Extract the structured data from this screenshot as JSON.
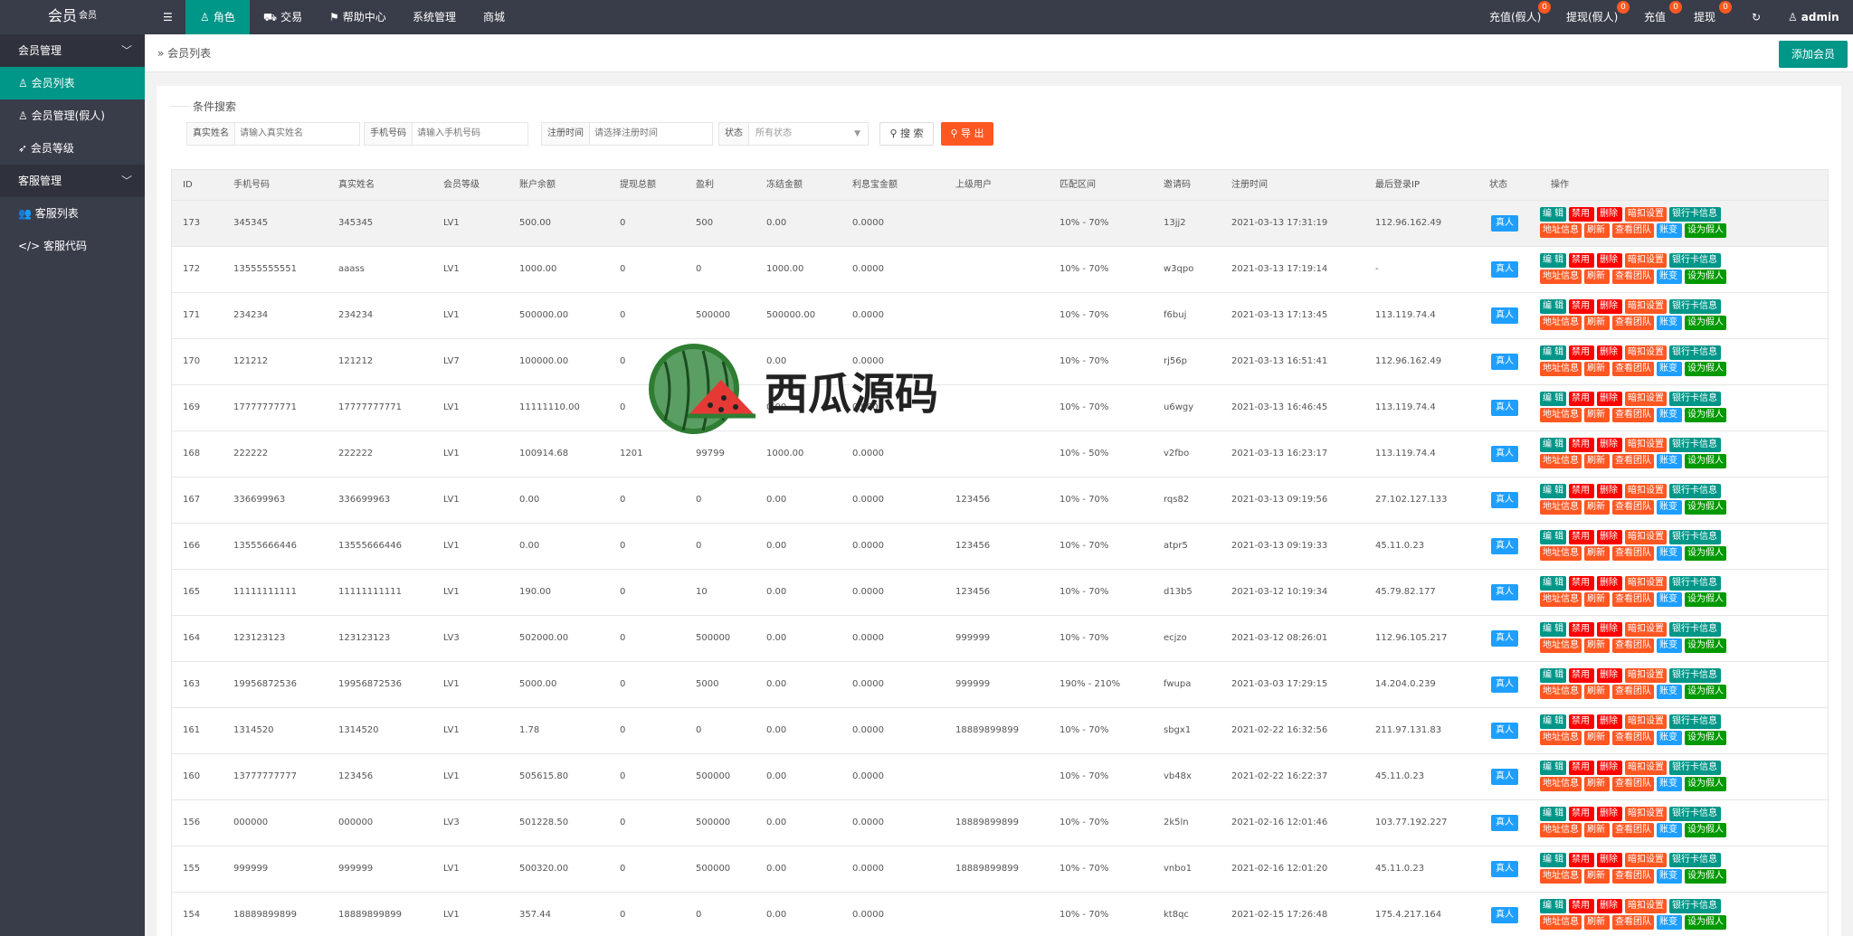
{
  "app": {
    "logo": "会员",
    "logo_sub": "会员"
  },
  "topnav": {
    "items": [
      "角色",
      "交易",
      "帮助中心",
      "系统管理",
      "商城"
    ],
    "right": [
      {
        "label": "充值(假人)",
        "count": "0"
      },
      {
        "label": "提现(假人)",
        "count": "0"
      },
      {
        "label": "充值",
        "count": "0"
      },
      {
        "label": "提现",
        "count": "0"
      }
    ],
    "user": "admin"
  },
  "sidebar": {
    "group1": "会员管理",
    "items1": [
      "会员列表",
      "会员管理(假人)",
      "会员等级"
    ],
    "group2": "客服管理",
    "items2": [
      "客服列表",
      "客服代码"
    ]
  },
  "breadcrumb": "会员列表",
  "add_button": "添加会员",
  "search": {
    "legend": "条件搜索",
    "fields": [
      {
        "label": "真实姓名",
        "placeholder": "请输入真实姓名"
      },
      {
        "label": "手机号码",
        "placeholder": "请输入手机号码"
      },
      {
        "label": "注册时间",
        "placeholder": "请选择注册时间"
      },
      {
        "label": "状态",
        "placeholder": "所有状态"
      }
    ],
    "search_btn": "搜 索",
    "export_btn": "导 出"
  },
  "table": {
    "columns": [
      "ID",
      "手机号码",
      "真实姓名",
      "会员等级",
      "账户余额",
      "提现总额",
      "盈利",
      "冻结金额",
      "利息宝金额",
      "上级用户",
      "匹配区间",
      "邀请码",
      "注册时间",
      "最后登录IP",
      "状态",
      "操作"
    ],
    "ops_row1": [
      "编 辑",
      "禁用",
      "删除",
      "暗扣设置",
      "银行卡信息"
    ],
    "ops_row2": [
      "地址信息",
      "刷新",
      "查看团队",
      "账变",
      "设为假人"
    ],
    "rows": [
      [
        "173",
        "345345",
        "345345",
        "LV1",
        "500.00",
        "0",
        "500",
        "0.00",
        "0.0000",
        "",
        "10% - 70%",
        "13jj2",
        "2021-03-13 17:31:19",
        "112.96.162.49",
        "真人"
      ],
      [
        "172",
        "13555555551",
        "aaass",
        "LV1",
        "1000.00",
        "0",
        "0",
        "1000.00",
        "0.0000",
        "",
        "10% - 70%",
        "w3qpo",
        "2021-03-13 17:19:14",
        "-",
        "真人"
      ],
      [
        "171",
        "234234",
        "234234",
        "LV1",
        "500000.00",
        "0",
        "500000",
        "500000.00",
        "0.0000",
        "",
        "10% - 70%",
        "f6buj",
        "2021-03-13 17:13:45",
        "113.119.74.4",
        "真人"
      ],
      [
        "170",
        "121212",
        "121212",
        "LV7",
        "100000.00",
        "0",
        "",
        "0.00",
        "0.0000",
        "",
        "10% - 70%",
        "rj56p",
        "2021-03-13 16:51:41",
        "112.96.162.49",
        "真人"
      ],
      [
        "169",
        "17777777771",
        "17777777771",
        "LV1",
        "11111110.00",
        "0",
        "",
        "0.00",
        "0.0000",
        "",
        "10% - 70%",
        "u6wgy",
        "2021-03-13 16:46:45",
        "113.119.74.4",
        "真人"
      ],
      [
        "168",
        "222222",
        "222222",
        "LV1",
        "100914.68",
        "1201",
        "99799",
        "1000.00",
        "0.0000",
        "",
        "10% - 50%",
        "v2fbo",
        "2021-03-13 16:23:17",
        "113.119.74.4",
        "真人"
      ],
      [
        "167",
        "336699963",
        "336699963",
        "LV1",
        "0.00",
        "0",
        "0",
        "0.00",
        "0.0000",
        "123456",
        "10% - 70%",
        "rqs82",
        "2021-03-13 09:19:56",
        "27.102.127.133",
        "真人"
      ],
      [
        "166",
        "13555666446",
        "13555666446",
        "LV1",
        "0.00",
        "0",
        "0",
        "0.00",
        "0.0000",
        "123456",
        "10% - 70%",
        "atpr5",
        "2021-03-13 09:19:33",
        "45.11.0.23",
        "真人"
      ],
      [
        "165",
        "11111111111",
        "11111111111",
        "LV1",
        "190.00",
        "0",
        "10",
        "0.00",
        "0.0000",
        "123456",
        "10% - 70%",
        "d13b5",
        "2021-03-12 10:19:34",
        "45.79.82.177",
        "真人"
      ],
      [
        "164",
        "123123123",
        "123123123",
        "LV3",
        "502000.00",
        "0",
        "500000",
        "0.00",
        "0.0000",
        "999999",
        "10% - 70%",
        "ecjzo",
        "2021-03-12 08:26:01",
        "112.96.105.217",
        "真人"
      ],
      [
        "163",
        "19956872536",
        "19956872536",
        "LV1",
        "5000.00",
        "0",
        "5000",
        "0.00",
        "0.0000",
        "999999",
        "190% - 210%",
        "fwupa",
        "2021-03-03 17:29:15",
        "14.204.0.239",
        "真人"
      ],
      [
        "161",
        "1314520",
        "1314520",
        "LV1",
        "1.78",
        "0",
        "0",
        "0.00",
        "0.0000",
        "18889899899",
        "10% - 70%",
        "sbgx1",
        "2021-02-22 16:32:56",
        "211.97.131.83",
        "真人"
      ],
      [
        "160",
        "13777777777",
        "123456",
        "LV1",
        "505615.80",
        "0",
        "500000",
        "0.00",
        "0.0000",
        "",
        "10% - 70%",
        "vb48x",
        "2021-02-22 16:22:37",
        "45.11.0.23",
        "真人"
      ],
      [
        "156",
        "000000",
        "000000",
        "LV3",
        "501228.50",
        "0",
        "500000",
        "0.00",
        "0.0000",
        "18889899899",
        "10% - 70%",
        "2k5ln",
        "2021-02-16 12:01:46",
        "103.77.192.227",
        "真人"
      ],
      [
        "155",
        "999999",
        "999999",
        "LV1",
        "500320.00",
        "0",
        "500000",
        "0.00",
        "0.0000",
        "18889899899",
        "10% - 70%",
        "vnbo1",
        "2021-02-16 12:01:20",
        "45.11.0.23",
        "真人"
      ],
      [
        "154",
        "18889899899",
        "18889899899",
        "LV1",
        "357.44",
        "0",
        "0",
        "0.00",
        "0.0000",
        "",
        "10% - 70%",
        "kt8qc",
        "2021-02-15 17:26:48",
        "175.4.217.164",
        "真人"
      ]
    ]
  },
  "watermark": "西瓜源码",
  "colors": {
    "dark": "#393d49",
    "accent": "#009688",
    "danger": "#ff0000",
    "warn": "#ff5722",
    "info": "#1e9fff",
    "ok": "#009900"
  }
}
